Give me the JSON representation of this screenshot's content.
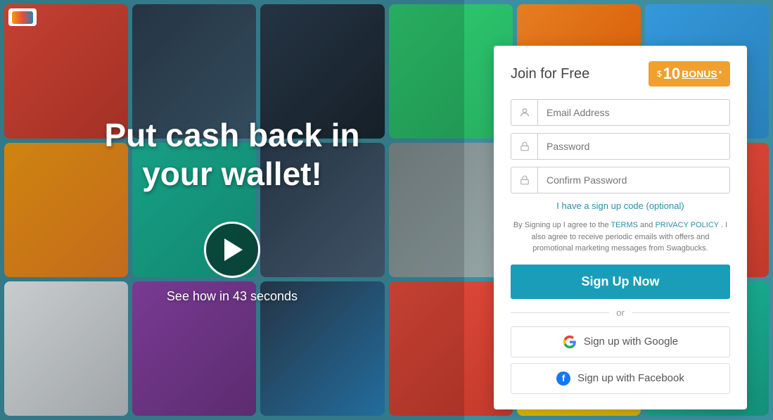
{
  "background": {
    "cards_count": 18
  },
  "logo": {
    "alt": "Swagbucks"
  },
  "hero": {
    "headline": "Put cash back in\nyour wallet!",
    "see_how_label": "See how in 43 seconds"
  },
  "bonus_badge": {
    "dollar": "$",
    "amount": "10",
    "word": "BONUS",
    "star": "*"
  },
  "panel": {
    "title": "Join for Free",
    "email_placeholder": "Email Address",
    "password_placeholder": "Password",
    "confirm_placeholder": "Confirm Password",
    "signup_code_label": "I have a sign up code (optional)",
    "terms_text_before": "By Signing up I agree to the ",
    "terms_link": "TERMS",
    "terms_and": " and ",
    "privacy_link": "PRIVACY POLICY",
    "terms_text_after": ". I also agree to receive periodic emails with offers and promotional marketing messages from Swagbucks.",
    "signup_btn_label": "Sign Up Now",
    "or_label": "or",
    "google_btn_label": "Sign up with Google",
    "facebook_btn_label": "Sign up with Facebook"
  }
}
